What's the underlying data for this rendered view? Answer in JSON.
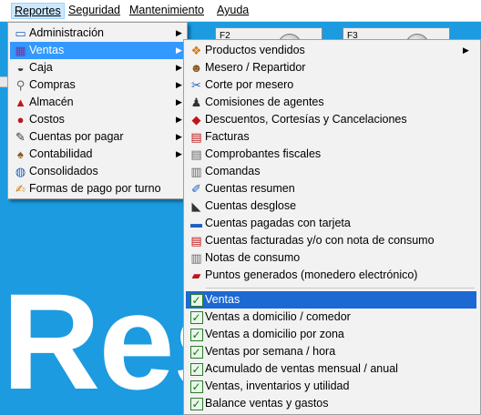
{
  "menubar": {
    "items": [
      {
        "label": "Reportes",
        "active": true
      },
      {
        "label": "Seguridad",
        "active": false
      },
      {
        "label": "Mantenimiento",
        "active": false
      },
      {
        "label": "Ayuda",
        "active": false
      }
    ]
  },
  "background": {
    "fkeys": [
      {
        "label": "F2"
      },
      {
        "label": "F3"
      }
    ],
    "big_text": "Res",
    "color": "#1c9be0"
  },
  "reportes_menu": {
    "items": [
      {
        "label": "Administración",
        "icon": "monitor-icon",
        "submenu": true
      },
      {
        "label": "Ventas",
        "icon": "sales-chart-icon",
        "submenu": true,
        "highlighted": true
      },
      {
        "label": "Caja",
        "icon": "cash-drawer-icon",
        "submenu": true
      },
      {
        "label": "Compras",
        "icon": "shopping-cart-icon",
        "submenu": true
      },
      {
        "label": "Almacén",
        "icon": "warehouse-icon",
        "submenu": true
      },
      {
        "label": "Costos",
        "icon": "coins-icon",
        "submenu": true
      },
      {
        "label": "Cuentas por pagar",
        "icon": "invoice-icon",
        "submenu": true
      },
      {
        "label": "Contabilidad",
        "icon": "ledger-icon",
        "submenu": true
      },
      {
        "label": "Consolidados",
        "icon": "globe-icon",
        "submenu": false
      },
      {
        "label": "Formas de pago por turno",
        "icon": "payment-icon",
        "submenu": false
      }
    ]
  },
  "ventas_menu": {
    "group1": [
      {
        "label": "Productos vendidos",
        "icon": "products-icon",
        "submenu": true
      },
      {
        "label": "Mesero / Repartidor",
        "icon": "waiter-icon",
        "submenu": false
      },
      {
        "label": "Corte por mesero",
        "icon": "cut-report-icon",
        "submenu": false
      },
      {
        "label": "Comisiones de agentes",
        "icon": "commission-icon",
        "submenu": false
      },
      {
        "label": "Descuentos, Cortesías y Cancelaciones",
        "icon": "discount-tag-icon",
        "submenu": false
      },
      {
        "label": "Facturas",
        "icon": "invoice-doc-icon",
        "submenu": false
      },
      {
        "label": "Comprobantes fiscales",
        "icon": "fiscal-doc-icon",
        "submenu": false
      },
      {
        "label": "Comandas",
        "icon": "order-ticket-icon",
        "submenu": false
      },
      {
        "label": "Cuentas resumen",
        "icon": "summary-icon",
        "submenu": false
      },
      {
        "label": "Cuentas desglose",
        "icon": "breakdown-icon",
        "submenu": false
      },
      {
        "label": "Cuentas pagadas con tarjeta",
        "icon": "credit-card-icon",
        "submenu": false
      },
      {
        "label": "Cuentas facturadas y/o con nota de consumo",
        "icon": "billed-account-icon",
        "submenu": false
      },
      {
        "label": "Notas de consumo",
        "icon": "consumption-note-icon",
        "submenu": false
      },
      {
        "label": "Puntos generados (monedero electrónico)",
        "icon": "wallet-points-icon",
        "submenu": false
      }
    ],
    "group2": [
      {
        "label": "Ventas",
        "icon": "checkbox-report-icon",
        "selected": true
      },
      {
        "label": "Ventas a domicilio / comedor",
        "icon": "checkbox-report-icon",
        "selected": false
      },
      {
        "label": "Ventas a domicilio por zona",
        "icon": "checkbox-report-icon",
        "selected": false
      },
      {
        "label": "Ventas por semana / hora",
        "icon": "checkbox-report-icon",
        "selected": false
      },
      {
        "label": "Acumulado de ventas mensual / anual",
        "icon": "checkbox-report-icon",
        "selected": false
      },
      {
        "label": "Ventas, inventarios y utilidad",
        "icon": "checkbox-report-icon",
        "selected": false
      },
      {
        "label": "Balance ventas y gastos",
        "icon": "checkbox-report-icon",
        "selected": false
      }
    ]
  },
  "colors": {
    "menu_highlight": "#3399ff",
    "selected_item": "#1c69d4",
    "menu_bg": "#f2f2f2"
  }
}
